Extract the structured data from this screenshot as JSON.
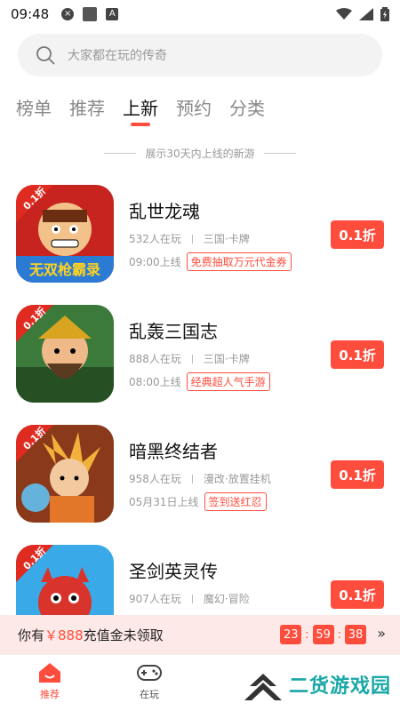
{
  "status": {
    "time": "09:48"
  },
  "search": {
    "placeholder": "大家都在玩的传奇"
  },
  "tabs": [
    {
      "label": "榜单",
      "active": false
    },
    {
      "label": "推荐",
      "active": false
    },
    {
      "label": "上新",
      "active": true
    },
    {
      "label": "预约",
      "active": false
    },
    {
      "label": "分类",
      "active": false
    }
  ],
  "subtitle": "展示30天内上线的新游",
  "games": [
    {
      "name": "乱世龙魂",
      "players": "532人在玩",
      "category": "三国·卡牌",
      "time": "09:00上线",
      "tag": "免费抽取万元代金券",
      "discount": "0.1折",
      "icon_badge": "0.1折",
      "icon_title": "无双枪霸录"
    },
    {
      "name": "乱轰三国志",
      "players": "888人在玩",
      "category": "三国·卡牌",
      "time": "08:00上线",
      "tag": "经典超人气手游",
      "discount": "0.1折",
      "icon_badge": "0.1折"
    },
    {
      "name": "暗黑终结者",
      "players": "958人在玩",
      "category": "漫改·放置挂机",
      "time": "05月31日上线",
      "tag": "签到送红忍",
      "discount": "0.1折",
      "icon_badge": "0.1折"
    },
    {
      "name": "圣剑英灵传",
      "players": "907人在玩",
      "category": "魔幻·冒险",
      "time": "",
      "tag": "",
      "discount": "0.1折",
      "icon_badge": "0.1折"
    }
  ],
  "recharge": {
    "prefix": "你有",
    "amount": "￥888",
    "suffix": "充值金未领取",
    "hours": "23",
    "minutes": "59",
    "seconds": "38",
    "arrow": "»"
  },
  "nav": [
    {
      "label": "推荐",
      "active": true
    },
    {
      "label": "在玩",
      "active": false
    }
  ],
  "watermark": "二货游戏园",
  "colors": {
    "accent": "#ff4d3d",
    "watermark": "#1aa7a7"
  }
}
